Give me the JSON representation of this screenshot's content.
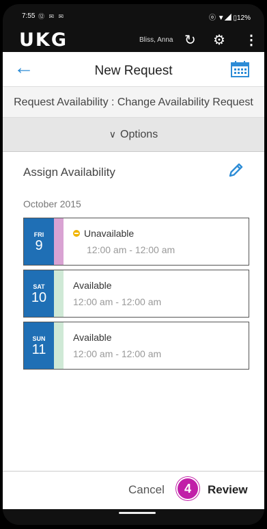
{
  "status_bar": {
    "time": "7:55",
    "icons": "⑫ ✉ ✉",
    "right": "ⓞ ▼◢ ▯12%"
  },
  "app_header": {
    "logo": "UKG",
    "user_name": "Bliss, Anna",
    "icons": [
      "refresh-icon",
      "gear-icon",
      "more-icon"
    ]
  },
  "title_bar": {
    "title": "New Request"
  },
  "subtitle": "Request Availability : Change Availability Request",
  "options": {
    "label": "Options"
  },
  "assign": {
    "title": "Assign Availability",
    "month": "October 2015"
  },
  "days": [
    {
      "dow": "FRI",
      "num": "9",
      "status": "Unavailable",
      "time": "12:00 am - 12:00 am",
      "strip_color": "#d9a3d3",
      "has_indicator": true
    },
    {
      "dow": "SAT",
      "num": "10",
      "status": "Available",
      "time": "12:00 am - 12:00 am",
      "strip_color": "#cfe9d6",
      "has_indicator": false
    },
    {
      "dow": "SUN",
      "num": "11",
      "status": "Available",
      "time": "12:00 am - 12:00 am",
      "strip_color": "#cfe9d6",
      "has_indicator": false
    }
  ],
  "footer": {
    "cancel": "Cancel",
    "step": "4",
    "review": "Review"
  },
  "colors": {
    "accent": "#2d8cd6",
    "date_block": "#1f6fb5",
    "step_badge": "#c11fa8",
    "unavailable_dot": "#f0b400"
  }
}
